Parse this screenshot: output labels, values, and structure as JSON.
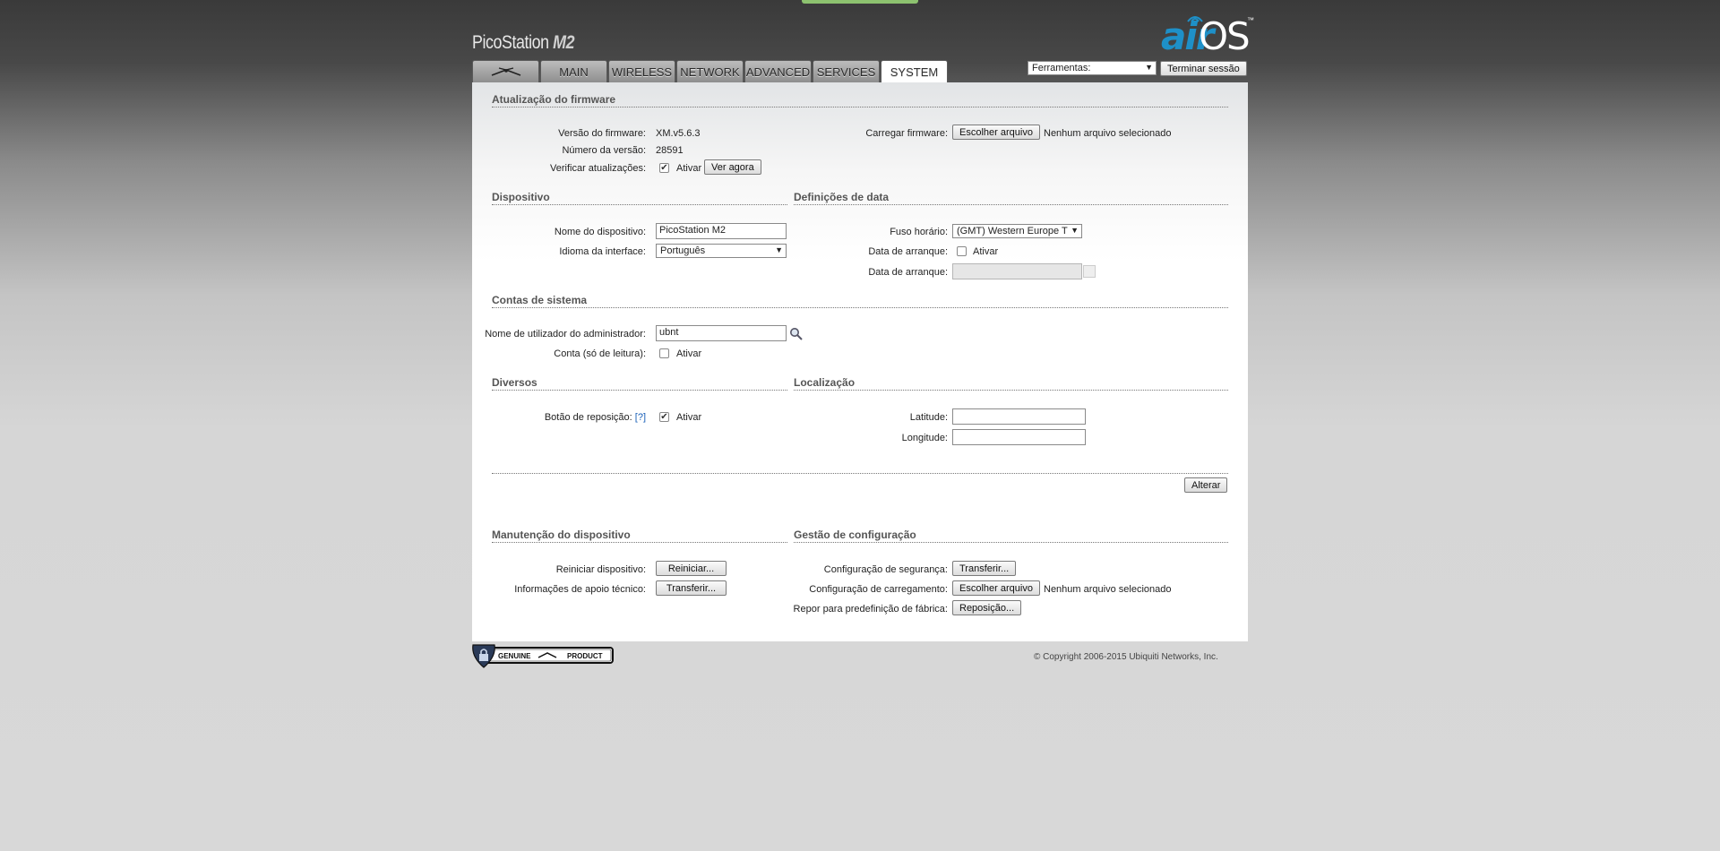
{
  "header": {
    "product_name": "PicoStation",
    "product_model": "M2",
    "logo_air": "air",
    "logo_os": "OS",
    "logo_tm": "™"
  },
  "tabs": [
    {
      "label": "",
      "icon": "ubiquiti-logo-icon"
    },
    {
      "label": "MAIN"
    },
    {
      "label": "WIRELESS"
    },
    {
      "label": "NETWORK"
    },
    {
      "label": "ADVANCED"
    },
    {
      "label": "SERVICES"
    },
    {
      "label": "SYSTEM",
      "active": true
    }
  ],
  "tools": {
    "select_value": "Ferramentas:",
    "logout_label": "Terminar sessão"
  },
  "firmware": {
    "title": "Atualização do firmware",
    "version_label": "Versão do firmware:",
    "version_value": "XM.v5.6.3",
    "build_label": "Número da versão:",
    "build_value": "28591",
    "check_label": "Verificar atualizações:",
    "check_enable": "Ativar",
    "check_now": "Ver agora",
    "upload_label": "Carregar firmware:",
    "choose_file": "Escolher arquivo",
    "no_file": "Nenhum arquivo selecionado"
  },
  "device": {
    "title": "Dispositivo",
    "name_label": "Nome do dispositivo:",
    "name_value": "PicoStation M2",
    "lang_label": "Idioma da interface:",
    "lang_value": "Português"
  },
  "date": {
    "title": "Definições de data",
    "tz_label": "Fuso horário:",
    "tz_value": "(GMT) Western Europe T",
    "startup_label": "Data de arranque:",
    "startup_enable": "Ativar",
    "startup_date_label": "Data de arranque:"
  },
  "accounts": {
    "title": "Contas de sistema",
    "admin_label": "Nome de utilizador do administrador:",
    "admin_value": "ubnt",
    "readonly_label": "Conta (só de leitura):",
    "readonly_enable": "Ativar"
  },
  "misc": {
    "title": "Diversos",
    "reset_label": "Botão de reposição:",
    "reset_help": "[?]",
    "reset_enable": "Ativar"
  },
  "location": {
    "title": "Localização",
    "lat_label": "Latitude:",
    "lon_label": "Longitude:"
  },
  "change_button": "Alterar",
  "maintenance": {
    "title": "Manutenção do dispositivo",
    "reboot_label": "Reiniciar dispositivo:",
    "reboot_button": "Reiniciar...",
    "support_label": "Informações de apoio técnico:",
    "support_button": "Transferir..."
  },
  "config": {
    "title": "Gestão de configuração",
    "backup_label": "Configuração de segurança:",
    "backup_button": "Transferir...",
    "upload_label": "Configuração de carregamento:",
    "choose_file": "Escolher arquivo",
    "no_file": "Nenhum arquivo selecionado",
    "reset_label": "Repor para predefinição de fábrica:",
    "reset_button": "Reposição..."
  },
  "footer": {
    "badge_left": "GENUINE",
    "badge_right": "PRODUCT",
    "copyright": "© Copyright 2006-2015 Ubiquiti Networks, Inc."
  }
}
